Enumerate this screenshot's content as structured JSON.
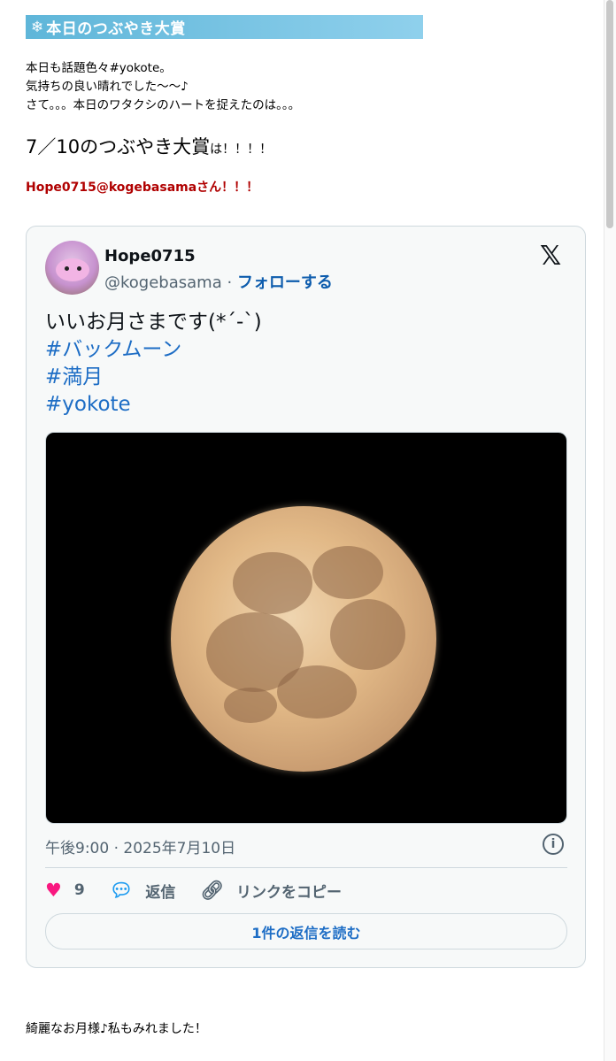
{
  "header": {
    "snow_icon": "❄",
    "title": "本日のつぶやき大賞"
  },
  "intro": [
    "本日も話題色々#yokote。",
    "気持ちの良い晴れでした〜〜♪",
    "さて。。。本日のワタクシのハートを捉えたのは。。。"
  ],
  "headline": {
    "main": "7／10のつぶやき大賞",
    "suffix": "は！！！！"
  },
  "winner": "Hope0715@kogebasamaさん！！！",
  "tweet": {
    "name": "Hope0715",
    "handle": "@kogebasama",
    "separator": "·",
    "follow": "フォローする",
    "text": "いいお月さまです(*´-`)",
    "hashtags": [
      "#バックムーン",
      "#満月",
      "#yokote"
    ],
    "timestamp": "午後9:00 · 2025年7月10日",
    "likes": "9",
    "reply": "返信",
    "copy_link": "リンクをコピー",
    "read_replies": "1件の返信を読む"
  },
  "footer": "綺麗なお月様♪私もみれました！",
  "colors": {
    "header_bg": "#6cc1e3",
    "winner": "#b00000",
    "link": "#1d6dc5",
    "heart": "#f91880"
  }
}
